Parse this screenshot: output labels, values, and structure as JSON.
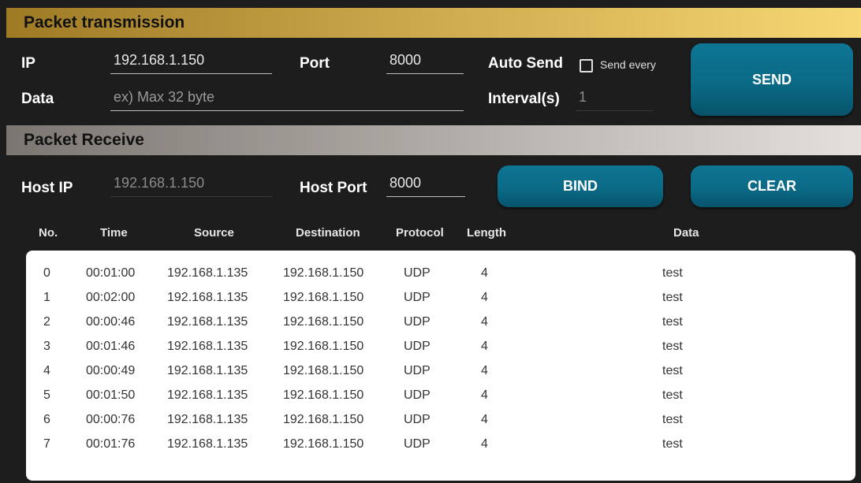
{
  "transmission": {
    "title": "Packet transmission",
    "ip_label": "IP",
    "ip_value": "192.168.1.150",
    "port_label": "Port",
    "port_value": "8000",
    "auto_send_label": "Auto Send",
    "send_every_label": "Send every",
    "send_every_checked": false,
    "data_label": "Data",
    "data_placeholder": "ex) Max 32 byte",
    "interval_label": "Interval(s)",
    "interval_value": "1",
    "send_button": "SEND"
  },
  "receive": {
    "title": "Packet Receive",
    "host_ip_label": "Host IP",
    "host_ip_value": "192.168.1.150",
    "host_port_label": "Host Port",
    "host_port_value": "8000",
    "bind_button": "BIND",
    "clear_button": "CLEAR"
  },
  "table": {
    "columns": [
      "No.",
      "Time",
      "Source",
      "Destination",
      "Protocol",
      "Length",
      "Data"
    ],
    "rows": [
      [
        "0",
        "00:01:00",
        "192.168.1.135",
        "192.168.1.150",
        "UDP",
        "4",
        "test"
      ],
      [
        "1",
        "00:02:00",
        "192.168.1.135",
        "192.168.1.150",
        "UDP",
        "4",
        "test"
      ],
      [
        "2",
        "00:00:46",
        "192.168.1.135",
        "192.168.1.150",
        "UDP",
        "4",
        "test"
      ],
      [
        "3",
        "00:01:46",
        "192.168.1.135",
        "192.168.1.150",
        "UDP",
        "4",
        "test"
      ],
      [
        "4",
        "00:00:49",
        "192.168.1.135",
        "192.168.1.150",
        "UDP",
        "4",
        "test"
      ],
      [
        "5",
        "00:01:50",
        "192.168.1.135",
        "192.168.1.150",
        "UDP",
        "4",
        "test"
      ],
      [
        "6",
        "00:00:76",
        "192.168.1.135",
        "192.168.1.150",
        "UDP",
        "4",
        "test"
      ],
      [
        "7",
        "00:01:76",
        "192.168.1.135",
        "192.168.1.150",
        "UDP",
        "4",
        "test"
      ]
    ]
  },
  "colors": {
    "background": "#1d1d1d",
    "button": "#0b6a86",
    "transmission_bar": "#c9a64a",
    "receive_bar": "#aaa5a0"
  }
}
